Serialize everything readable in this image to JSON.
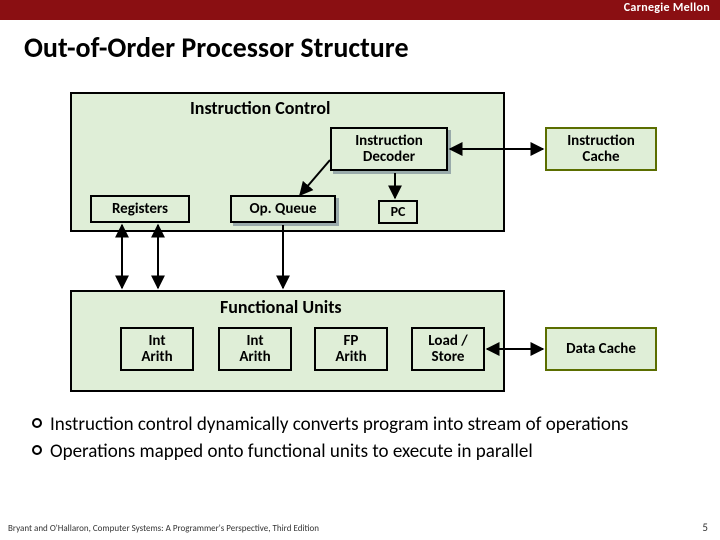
{
  "header": {
    "institution": "Carnegie Mellon"
  },
  "title": "Out-of-Order Processor Structure",
  "instruction_control": {
    "label": "Instruction Control",
    "decoder": "Instruction\nDecoder",
    "cache": "Instruction\nCache",
    "registers": "Registers",
    "opqueue": "Op. Queue",
    "pc": "PC"
  },
  "functional_units": {
    "label": "Functional Units",
    "units": [
      "Int\nArith",
      "Int\nArith",
      "FP\nArith",
      "Load /\nStore"
    ],
    "data_cache": "Data Cache"
  },
  "bullets": [
    "Instruction control dynamically converts program into stream of operations",
    "Operations mapped onto functional units to execute in parallel"
  ],
  "footer": "Bryant and O'Hallaron, Computer Systems: A Programmer's Perspective, Third Edition",
  "page": "5"
}
